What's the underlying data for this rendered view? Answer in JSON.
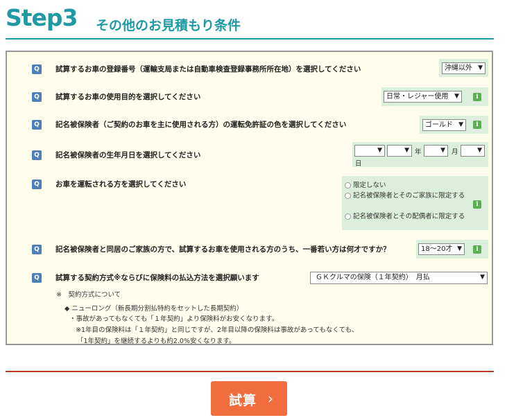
{
  "header": {
    "step": "Step3",
    "title": "その他のお見積もり条件"
  },
  "questions": [
    {
      "q": "Q",
      "text": "試算するお車の登録番号（運輸支局または自動車検査登録事務所所在地）を選択してください",
      "value": "沖縄以外"
    },
    {
      "q": "Q",
      "text": "試算するお車の使用目的を選択してください",
      "value": "日常・レジャー使用"
    },
    {
      "q": "Q",
      "text": "記名被保険者（ご契約のお車を主に使用される方）の運転免許証の色を選択してください",
      "value": "ゴールド"
    },
    {
      "q": "Q",
      "text": "記名被保険者の生年月日を選択してください",
      "year_label": "年",
      "month_label": "月",
      "day_label": "日"
    },
    {
      "q": "Q",
      "text": "お車を運転される方を選択してください",
      "options": [
        "限定しない",
        "記名被保険者とそのご家族に限定する",
        "記名被保険者とその配偶者に限定する"
      ]
    },
    {
      "q": "Q",
      "text": "記名被保険者と同居のご家族の方で、試算するお車を使用される方のうち、一番若い方は何才ですか？",
      "value": "18～20才"
    },
    {
      "q": "Q",
      "text": "試算する契約方式※ならびに保険料の払込方法を選択願います",
      "value": "ＧＫクルマの保険（１年契約）　月払"
    }
  ],
  "info_icon": "i",
  "dropdown_arrow": "▼",
  "notes": {
    "heading": "※　契約方式について",
    "bullet": "◆ ニューロング（新長期分割払特約をセットした長期契約）",
    "line1": "・事故があってもなくても「１年契約」より保険料がお安くなります。",
    "line2": "※1年目の保険料は「１年契約」と同じですが、2年目以降の保険料は事故があってもなくても、",
    "line3": "「1年契約」を継続するよりも約2.0%安くなります。"
  },
  "button": {
    "label": "試算",
    "chevron": "›"
  },
  "colors": {
    "accent": "#1f9aa3",
    "button": "#f26d3d",
    "panel_bg": "#fffdec",
    "control_bg": "#dcefdc",
    "rule_red": "#c0392b"
  }
}
